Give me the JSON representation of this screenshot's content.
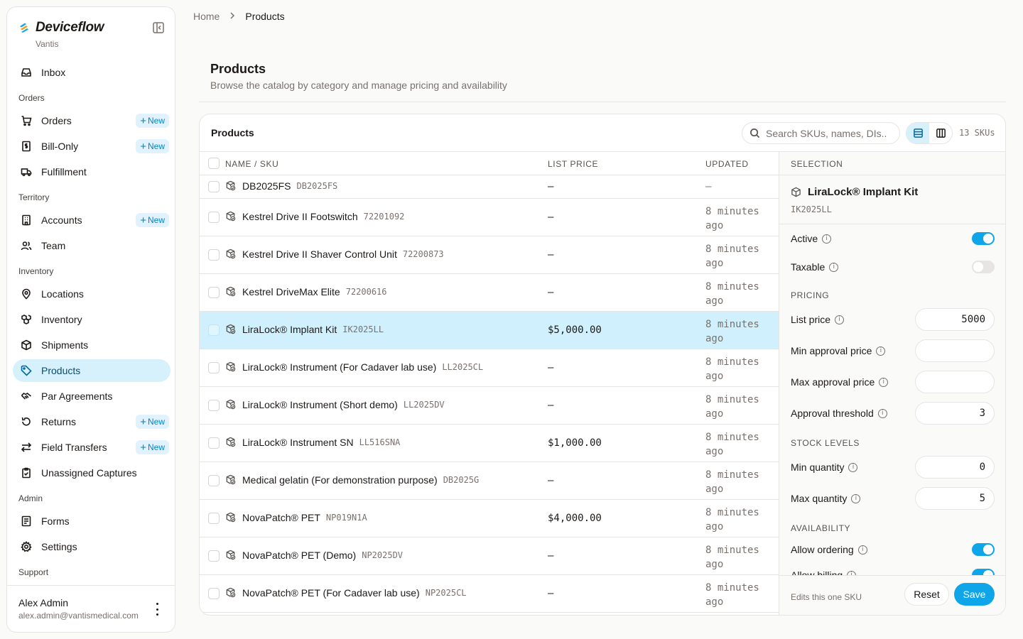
{
  "brand": {
    "name": "Deviceflow",
    "org": "Vantis"
  },
  "sidebar": {
    "items": [
      {
        "type": "item",
        "label": "Inbox",
        "icon": "inbox-icon"
      },
      {
        "type": "section",
        "label": "Orders"
      },
      {
        "type": "item",
        "label": "Orders",
        "icon": "cart-icon",
        "badge": "New"
      },
      {
        "type": "item",
        "label": "Bill-Only",
        "icon": "invoice-icon",
        "badge": "New"
      },
      {
        "type": "item",
        "label": "Fulfillment",
        "icon": "truck-icon"
      },
      {
        "type": "section",
        "label": "Territory"
      },
      {
        "type": "item",
        "label": "Accounts",
        "icon": "building-icon",
        "badge": "New"
      },
      {
        "type": "item",
        "label": "Team",
        "icon": "users-icon"
      },
      {
        "type": "section",
        "label": "Inventory"
      },
      {
        "type": "item",
        "label": "Locations",
        "icon": "map-pin-icon"
      },
      {
        "type": "item",
        "label": "Inventory",
        "icon": "boxes-icon"
      },
      {
        "type": "item",
        "label": "Shipments",
        "icon": "package-icon"
      },
      {
        "type": "item",
        "label": "Products",
        "icon": "tag-icon",
        "active": true
      },
      {
        "type": "item",
        "label": "Par Agreements",
        "icon": "handshake-icon"
      },
      {
        "type": "item",
        "label": "Returns",
        "icon": "undo-icon",
        "badge": "New"
      },
      {
        "type": "item",
        "label": "Field Transfers",
        "icon": "transfer-icon",
        "badge": "New"
      },
      {
        "type": "item",
        "label": "Unassigned Captures",
        "icon": "clipboard-icon"
      },
      {
        "type": "section",
        "label": "Admin"
      },
      {
        "type": "item",
        "label": "Forms",
        "icon": "form-icon"
      },
      {
        "type": "item",
        "label": "Settings",
        "icon": "gear-icon"
      },
      {
        "type": "section",
        "label": "Support"
      }
    ],
    "user": {
      "name": "Alex Admin",
      "email": "alex.admin@vantismedical.com"
    }
  },
  "breadcrumb": {
    "home": "Home",
    "current": "Products"
  },
  "page": {
    "title": "Products",
    "subtitle": "Browse the catalog by category and manage pricing and availability"
  },
  "card": {
    "title": "Products",
    "search_placeholder": "Search SKUs, names, DIs...",
    "sku_count": "13 SKUs"
  },
  "table": {
    "columns": {
      "name": "NAME / SKU",
      "price": "LIST PRICE",
      "updated": "UPDATED"
    },
    "rows": [
      {
        "name": "DB2025FS",
        "sku": "DB2025FS",
        "price": "—",
        "updated": "—"
      },
      {
        "name": "Kestrel Drive II Footswitch",
        "sku": "72201092",
        "price": "—",
        "updated": "8 minutes ago"
      },
      {
        "name": "Kestrel Drive II Shaver Control Unit",
        "sku": "72200873",
        "price": "—",
        "updated": "8 minutes ago"
      },
      {
        "name": "Kestrel DriveMax Elite",
        "sku": "72200616",
        "price": "—",
        "updated": "8 minutes ago"
      },
      {
        "name": "LiraLock® Implant Kit",
        "sku": "IK2025LL",
        "price": "$5,000.00",
        "updated": "8 minutes ago",
        "selected": true
      },
      {
        "name": "LiraLock® Instrument (For Cadaver lab use)",
        "sku": "LL2025CL",
        "price": "—",
        "updated": "8 minutes ago"
      },
      {
        "name": "LiraLock® Instrument (Short demo)",
        "sku": "LL2025DV",
        "price": "—",
        "updated": "8 minutes ago"
      },
      {
        "name": "LiraLock® Instrument SN",
        "sku": "LL516SNA",
        "price": "$1,000.00",
        "updated": "8 minutes ago"
      },
      {
        "name": "Medical gelatin (For demonstration purpose)",
        "sku": "DB2025G",
        "price": "—",
        "updated": "8 minutes ago"
      },
      {
        "name": "NovaPatch® PET",
        "sku": "NP019N1A",
        "price": "$4,000.00",
        "updated": "8 minutes ago"
      },
      {
        "name": "NovaPatch® PET (Demo)",
        "sku": "NP2025DV",
        "price": "—",
        "updated": "8 minutes ago"
      },
      {
        "name": "NovaPatch® PET (For Cadaver lab use)",
        "sku": "NP2025CL",
        "price": "—",
        "updated": "8 minutes ago"
      }
    ]
  },
  "selection": {
    "header": "SELECTION",
    "name": "LiraLock® Implant Kit",
    "sku": "IK2025LL",
    "active_label": "Active",
    "active": true,
    "taxable_label": "Taxable",
    "taxable": false,
    "pricing_header": "PRICING",
    "list_price_label": "List price",
    "list_price": "5000",
    "min_approval_label": "Min approval price",
    "min_approval": "",
    "max_approval_label": "Max approval price",
    "max_approval": "",
    "threshold_label": "Approval threshold",
    "threshold": "3",
    "stock_header": "STOCK LEVELS",
    "min_qty_label": "Min quantity",
    "min_qty": "0",
    "max_qty_label": "Max quantity",
    "max_qty": "5",
    "availability_header": "AVAILABILITY",
    "allow_ordering_label": "Allow ordering",
    "allow_ordering": true,
    "allow_billing_label": "Allow billing",
    "allow_billing": true,
    "footer_note": "Edits this one SKU",
    "reset_label": "Reset",
    "save_label": "Save"
  },
  "colors": {
    "accent": "#0ea5e9",
    "active_bg": "#d6f1fb",
    "selected_row": "#cff0fc"
  }
}
